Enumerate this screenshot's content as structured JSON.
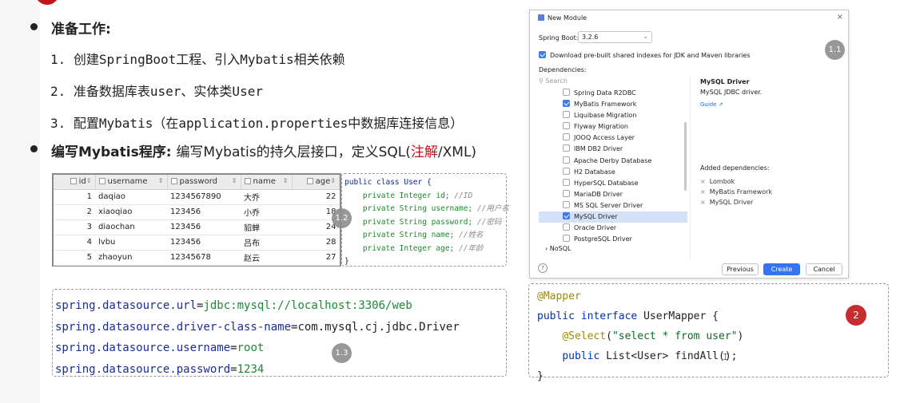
{
  "section1": {
    "heading": "准备工作:",
    "steps": [
      "1. 创建SpringBoot工程、引入Mybatis相关依赖",
      "2. 准备数据库表user、实体类User",
      "3. 配置Mybatis（在application.properties中数据库连接信息）"
    ]
  },
  "section2": {
    "heading": "编写Mybatis程序:",
    "text_before": "编写Mybatis的持久层接口，定义SQL(",
    "highlight": "注解",
    "text_after": "/XML)"
  },
  "badges": {
    "b11": "1.1",
    "b12": "1.2",
    "b13": "1.3",
    "b2": "2"
  },
  "db_table": {
    "columns": [
      "id",
      "username",
      "password",
      "name",
      "age"
    ],
    "rows": [
      [
        "1",
        "daqiao",
        "1234567890",
        "大乔",
        "22"
      ],
      [
        "2",
        "xiaoqiao",
        "123456",
        "小乔",
        "18"
      ],
      [
        "3",
        "diaochan",
        "123456",
        "貂蝉",
        "24"
      ],
      [
        "4",
        "lvbu",
        "123456",
        "吕布",
        "28"
      ],
      [
        "5",
        "zhaoyun",
        "12345678",
        "赵云",
        "27"
      ]
    ]
  },
  "user_class": {
    "header": "public class User {",
    "fields": [
      {
        "decl": "private Integer id;",
        "comment": "//ID"
      },
      {
        "decl": "private String username;",
        "comment": "//用户名"
      },
      {
        "decl": "private String password;",
        "comment": "//密码"
      },
      {
        "decl": "private String name;",
        "comment": "//姓名"
      },
      {
        "decl": "private Integer age;",
        "comment": "//年龄"
      }
    ],
    "footer": "}"
  },
  "properties": [
    {
      "key": "spring.datasource.url",
      "value": "jdbc:mysql://localhost:3306/web"
    },
    {
      "key": "spring.datasource.driver-class-name",
      "value": "com.mysql.cj.jdbc.Driver"
    },
    {
      "key": "spring.datasource.username",
      "value": "root"
    },
    {
      "key": "spring.datasource.password",
      "value": "1234"
    }
  ],
  "mapper": {
    "annotation": "@Mapper",
    "decl_kw": "public interface",
    "decl_name": "UserMapper {",
    "select_anno": "@Select",
    "select_open": "(",
    "select_sql": "\"select * from user\"",
    "select_close": ")",
    "method_kw": "public",
    "method_rest": "List<User> findAll();",
    "close": "}"
  },
  "dialog": {
    "title": "New Module",
    "close": "×",
    "spring_boot_label": "Spring Boot:",
    "spring_boot_version": "3.2.6",
    "download_label": "Download pre-built shared indexes for JDK and Maven libraries",
    "dependencies_label": "Dependencies:",
    "search_placeholder": "Search",
    "dependency_items": [
      {
        "label": "Spring Data R2DBC",
        "checked": false,
        "selected": false
      },
      {
        "label": "MyBatis Framework",
        "checked": true,
        "selected": false
      },
      {
        "label": "Liquibase Migration",
        "checked": false,
        "selected": false
      },
      {
        "label": "Flyway Migration",
        "checked": false,
        "selected": false
      },
      {
        "label": "JOOQ Access Layer",
        "checked": false,
        "selected": false
      },
      {
        "label": "IBM DB2 Driver",
        "checked": false,
        "selected": false
      },
      {
        "label": "Apache Derby Database",
        "checked": false,
        "selected": false
      },
      {
        "label": "H2 Database",
        "checked": false,
        "selected": false
      },
      {
        "label": "HyperSQL Database",
        "checked": false,
        "selected": false
      },
      {
        "label": "MariaDB Driver",
        "checked": false,
        "selected": false
      },
      {
        "label": "MS SQL Server Driver",
        "checked": false,
        "selected": false
      },
      {
        "label": "MySQL Driver",
        "checked": true,
        "selected": true
      },
      {
        "label": "Oracle Driver",
        "checked": false,
        "selected": false
      },
      {
        "label": "PostgreSQL Driver",
        "checked": false,
        "selected": false
      }
    ],
    "nosql_label": "NoSQL",
    "info_title": "MySQL Driver",
    "info_desc": "MySQL JDBC driver.",
    "guide_link": "Guide ↗",
    "added_label": "Added dependencies:",
    "added": [
      "Lombok",
      "MyBatis Framework",
      "MySQL Driver"
    ],
    "help": "?",
    "previous": "Previous",
    "create": "Create",
    "cancel": "Cancel"
  }
}
